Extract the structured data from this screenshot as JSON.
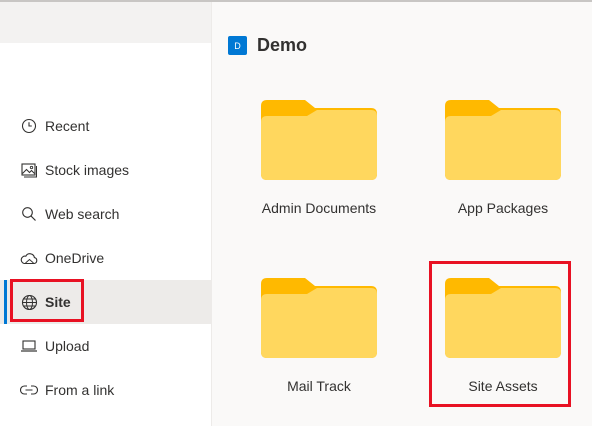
{
  "sidebar": {
    "items": [
      {
        "label": "Recent",
        "icon": "clock-icon"
      },
      {
        "label": "Stock images",
        "icon": "image-icon"
      },
      {
        "label": "Web search",
        "icon": "search-icon"
      },
      {
        "label": "OneDrive",
        "icon": "cloud-icon"
      },
      {
        "label": "Site",
        "icon": "globe-icon",
        "selected": true
      },
      {
        "label": "Upload",
        "icon": "laptop-icon"
      },
      {
        "label": "From a link",
        "icon": "link-icon"
      }
    ]
  },
  "main": {
    "site": {
      "badge": "D",
      "title": "Demo"
    },
    "folders": [
      {
        "label": "Admin Documents"
      },
      {
        "label": "App Packages"
      },
      {
        "label": "Mail Track"
      },
      {
        "label": "Site Assets",
        "highlighted": true
      }
    ]
  },
  "colors": {
    "accent": "#0078d4",
    "folder_back": "#ffb900",
    "folder_front": "#ffd75e",
    "highlight": "#e81123",
    "selected_bg": "#edebe9"
  }
}
